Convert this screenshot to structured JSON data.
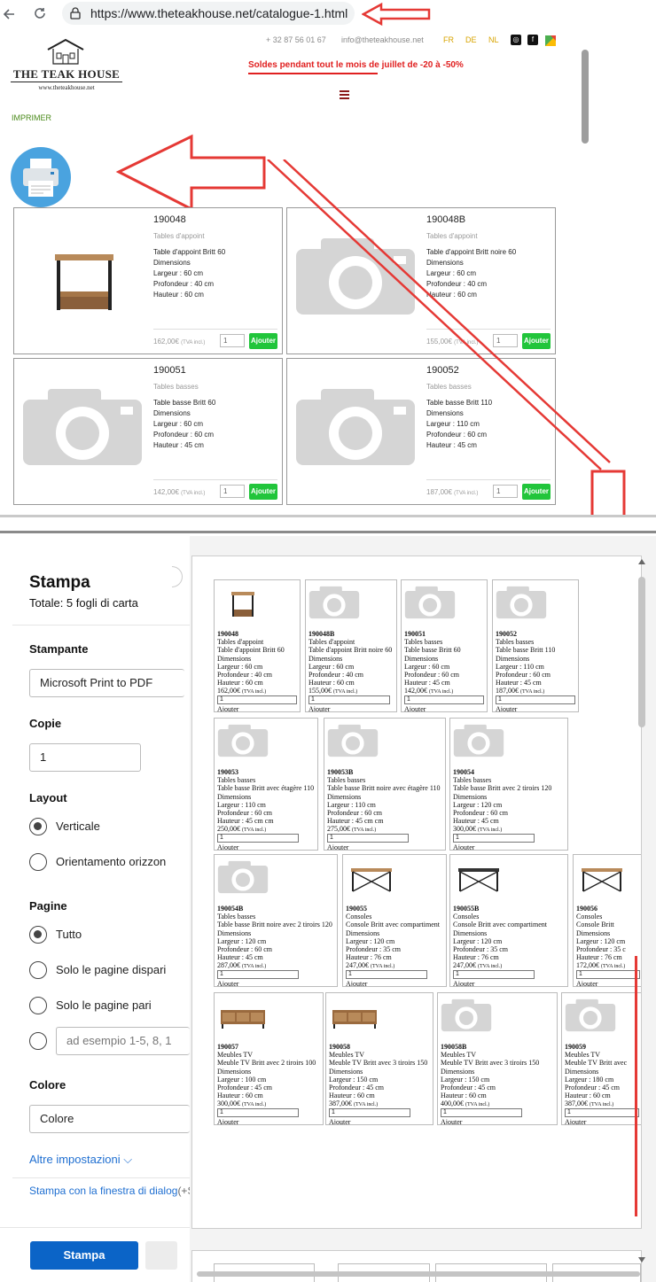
{
  "browser": {
    "url": "https://www.theteakhouse.net/catalogue-1.html"
  },
  "site": {
    "logo_text": "THE TEAK HOUSE",
    "logo_sub": "www.theteakhouse.net",
    "phone": "+ 32 87 56 01 67",
    "email": "info@theteakhouse.net",
    "languages": [
      "FR",
      "DE",
      "NL"
    ],
    "sale_banner": "Soldes pendant tout le mois de juillet de -20 à -50%",
    "print_link": "IMPRIMER",
    "products": [
      {
        "ref": "190048",
        "category": "Tables d'appoint",
        "desc": "Table d'appoint Britt 60\nDimensions\nLargeur : 60 cm\nProfondeur : 40 cm\nHauteur : 60 cm",
        "price": "162,00€",
        "tva": "(TVA incl.)",
        "qty": "1",
        "add": "Ajouter",
        "image": "table-photo"
      },
      {
        "ref": "190048B",
        "category": "Tables d'appoint",
        "desc": "Table d'appoint Britt noire 60\nDimensions\nLargeur : 60 cm\nProfondeur : 40 cm\nHauteur : 60 cm",
        "price": "155,00€",
        "tva": "(TVA incl.)",
        "qty": "1",
        "add": "Ajouter",
        "image": "camera-placeholder"
      },
      {
        "ref": "190051",
        "category": "Tables basses",
        "desc": "Table basse Britt 60\nDimensions\nLargeur : 60 cm\nProfondeur : 60 cm\nHauteur : 45 cm",
        "price": "142,00€",
        "tva": "(TVA incl.)",
        "qty": "1",
        "add": "Ajouter",
        "image": "camera-placeholder"
      },
      {
        "ref": "190052",
        "category": "Tables basses",
        "desc": "Table basse Britt 110\nDimensions\nLargeur : 110 cm\nProfondeur : 60 cm\nHauteur : 45 cm",
        "price": "187,00€",
        "tva": "(TVA incl.)",
        "qty": "1",
        "add": "Ajouter",
        "image": "camera-placeholder"
      }
    ]
  },
  "print_dialog": {
    "title": "Stampa",
    "total": "Totale: 5 fogli di carta",
    "printer_label": "Stampante",
    "printer_value": "Microsoft Print to PDF",
    "copies_label": "Copie",
    "copies_value": "1",
    "layout_label": "Layout",
    "layout_options": [
      "Verticale",
      "Orientamento orizzon"
    ],
    "pages_label": "Pagine",
    "pages_options": [
      "Tutto",
      "Solo le pagine dispari",
      "Solo le pagine pari"
    ],
    "pages_custom_placeholder": "ad esempio 1-5, 8, 1",
    "color_label": "Colore",
    "color_value": "Colore",
    "more_settings": "Altre impostazioni",
    "system_dialog": "Stampa con la finestra di dialog",
    "system_dialog_shortcut": "(+S",
    "print_button": "Stampa"
  },
  "preview_rows": [
    [
      {
        "ref": "190048",
        "txt": "Tables d'appoint\nTable d'appoint Britt 60\nDimensions\nLargeur : 60 cm\nProfondeur : 40 cm\nHauteur : 60 cm",
        "price": "162,00€",
        "tva": "(TVA incl.)",
        "qty": "1",
        "add": "Ajouter",
        "image": "table-photo"
      },
      {
        "ref": "190048B",
        "txt": "Tables d'appoint\nTable d'appoint Britt noire 60\nDimensions\nLargeur : 60 cm\nProfondeur : 40 cm\nHauteur : 60 cm",
        "price": "155,00€",
        "tva": "(TVA incl.)",
        "qty": "1",
        "add": "Ajouter",
        "image": "camera-placeholder"
      },
      {
        "ref": "190051",
        "txt": "Tables basses\nTable basse Britt 60\nDimensions\nLargeur : 60 cm\nProfondeur : 60 cm\nHauteur : 45 cm",
        "price": "142,00€",
        "tva": "(TVA incl.)",
        "qty": "1",
        "add": "Ajouter",
        "image": "camera-placeholder"
      },
      {
        "ref": "190052",
        "txt": "Tables basses\nTable basse Britt 110\nDimensions\nLargeur : 110 cm\nProfondeur : 60 cm\nHauteur : 45 cm",
        "price": "187,00€",
        "tva": "(TVA incl.)",
        "qty": "1",
        "add": "Ajouter",
        "image": "camera-placeholder"
      }
    ],
    [
      {
        "ref": "190053",
        "txt": "Tables basses\nTable basse Britt avec étagère 110\nDimensions\nLargeur : 110 cm\nProfondeur : 60 cm\nHauteur : 45 cm cm",
        "price": "250,00€",
        "tva": "(TVA incl.)",
        "qty": "1",
        "add": "Ajouter",
        "image": "camera-placeholder"
      },
      {
        "ref": "190053B",
        "txt": "Tables basses\nTable basse Britt noire avec étagère 110\nDimensions\nLargeur : 110 cm\nProfondeur : 60 cm\nHauteur : 45 cm cm",
        "price": "275,00€",
        "tva": "(TVA incl.)",
        "qty": "1",
        "add": "Ajouter",
        "image": "camera-placeholder"
      },
      {
        "ref": "190054",
        "txt": "Tables basses\nTable basse Britt avec 2 tiroirs 120\nDimensions\nLargeur : 120 cm\nProfondeur : 60 cm\nHauteur : 45 cm",
        "price": "300,00€",
        "tva": "(TVA incl.)",
        "qty": "1",
        "add": "Ajouter",
        "image": "camera-placeholder"
      }
    ],
    [
      {
        "ref": "190054B",
        "txt": "Tables basses\nTable basse Britt noire avec 2 tiroirs 120\nDimensions\nLargeur : 120 cm\nProfondeur : 60 cm\nHauteur : 45 cm",
        "price": "287,00€",
        "tva": "(TVA incl.)",
        "qty": "1",
        "add": "Ajouter",
        "image": "camera-placeholder"
      },
      {
        "ref": "190055",
        "txt": "Consoles\nConsole Britt avec compartiment\nDimensions\nLargeur : 120 cm\nProfondeur : 35 cm\nHauteur : 76 cm",
        "price": "247,00€",
        "tva": "(TVA incl.)",
        "qty": "1",
        "add": "Ajouter",
        "image": "console-photo"
      },
      {
        "ref": "190055B",
        "txt": "Consoles\nConsole Britt avec compartiment\nDimensions\nLargeur : 120 cm\nProfondeur : 35 cm\nHauteur : 76 cm",
        "price": "247,00€",
        "tva": "(TVA incl.)",
        "qty": "1",
        "add": "Ajouter",
        "image": "console-black-photo"
      },
      {
        "ref": "190056",
        "txt": "Consoles\nConsole Britt\nDimensions\nLargeur : 120 cm\nProfondeur : 35 c\nHauteur : 76 cm",
        "price": "172,00€",
        "tva": "(TVA incl.)",
        "qty": "1",
        "add": "Ajouter",
        "image": "console-photo"
      }
    ],
    [
      {
        "ref": "190057",
        "txt": "Meubles TV\nMeuble TV Britt avec 2 tiroirs 100\nDimensions\nLargeur : 100 cm\nProfondeur : 45 cm\nHauteur : 60 cm",
        "price": "300,00€",
        "tva": "(TVA incl.)",
        "qty": "1",
        "add": "Ajouter",
        "image": "tv-photo"
      },
      {
        "ref": "190058",
        "txt": "Meubles TV\nMeuble TV Britt avec 3 tiroirs 150\nDimensions\nLargeur : 150 cm\nProfondeur : 45 cm\nHauteur : 60 cm",
        "price": "387,00€",
        "tva": "(TVA incl.)",
        "qty": "1",
        "add": "Ajouter",
        "image": "tv-photo"
      },
      {
        "ref": "190058B",
        "txt": "Meubles TV\nMeuble TV Britt avec 3 tiroirs 150\nDimensions\nLargeur : 150 cm\nProfondeur : 45 cm\nHauteur : 60 cm",
        "price": "400,00€",
        "tva": "(TVA incl.)",
        "qty": "1",
        "add": "Ajouter",
        "image": "camera-placeholder"
      },
      {
        "ref": "190059",
        "txt": "Meubles TV\nMeuble TV Britt avec\nDimensions\nLargeur : 180 cm\nProfondeur : 45 cm\nHauteur : 60 cm",
        "price": "387,00€",
        "tva": "(TVA incl.)",
        "qty": "1",
        "add": "Ajouter",
        "image": "camera-placeholder"
      }
    ]
  ],
  "colors": {
    "accent_red": "#e53935",
    "add_green": "#21c53b",
    "print_blue": "#0b64c7",
    "link_blue": "#1f6fd1",
    "lang_yellow": "#d8a400"
  }
}
